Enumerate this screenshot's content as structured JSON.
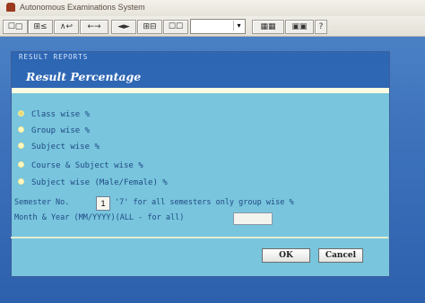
{
  "window": {
    "title": "Autonomous Examinations System"
  },
  "toolbar": {
    "buttons": [
      {
        "label": "☐▢",
        "icon": "new-open-icon"
      },
      {
        "label": "⊞≤",
        "icon": "edit-icon"
      },
      {
        "label": "∧↩",
        "icon": "undo-icon"
      },
      {
        "label": "←→",
        "icon": "navigation-icon"
      },
      {
        "label": "◄►",
        "icon": "record-nav-icon"
      },
      {
        "label": "⊞⊟",
        "icon": "grid-icon"
      },
      {
        "label": "☐☐",
        "icon": "window-icon"
      },
      {
        "label": "▦▦",
        "icon": "layout-icon"
      },
      {
        "label": "▣▣",
        "icon": "print-icon"
      },
      {
        "label": "?",
        "icon": "help-icon"
      }
    ],
    "combo_value": ""
  },
  "panel": {
    "header": "RESULT REPORTS",
    "title": "Result Percentage"
  },
  "options": [
    {
      "label": "Class wise %",
      "selected": true
    },
    {
      "label": "Group wise %",
      "selected": false
    },
    {
      "label": "Subject wise %",
      "selected": false
    },
    {
      "label": "Course & Subject wise %",
      "selected": false
    },
    {
      "label": "Subject wise (Male/Female) %",
      "selected": false
    }
  ],
  "form": {
    "semester_label": "Semester No.",
    "semester_value": "1",
    "semester_hint": "'7' for all semesters only group wise %",
    "month_label": "Month & Year (MM/YYYY)(ALL - for all)",
    "month_value": ""
  },
  "buttons": {
    "ok": "OK",
    "cancel": "Cancel"
  },
  "colors": {
    "panel_bg": "#78c5dd",
    "title_bar": "#2e67b4",
    "text": "#214a85"
  }
}
